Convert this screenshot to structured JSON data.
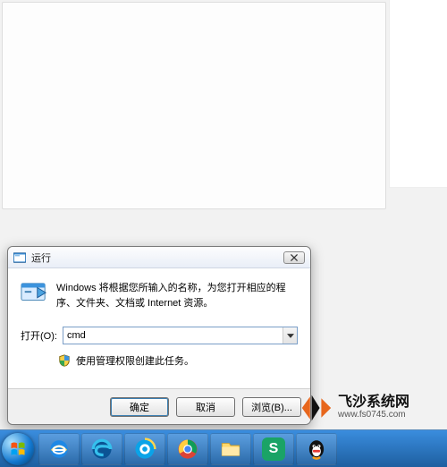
{
  "dialog": {
    "title": "运行",
    "description": "Windows 将根据您所输入的名称，为您打开相应的程序、文件夹、文档或 Internet 资源。",
    "open_label": "打开(O):",
    "input_value": "cmd",
    "admin_note": "使用管理权限创建此任务。",
    "buttons": {
      "ok": "确定",
      "cancel": "取消",
      "browse": "浏览(B)..."
    }
  },
  "taskbar": {
    "items": [
      {
        "name": "start-orb",
        "icon": "windows-logo"
      },
      {
        "name": "internet-explorer",
        "icon": "ie"
      },
      {
        "name": "microsoft-edge",
        "icon": "edge"
      },
      {
        "name": "qq-browser",
        "icon": "qqbrowser"
      },
      {
        "name": "google-chrome",
        "icon": "chrome"
      },
      {
        "name": "file-explorer",
        "icon": "explorer"
      },
      {
        "name": "wps-spreadsheet",
        "icon": "wps-s"
      },
      {
        "name": "qq",
        "icon": "qq"
      }
    ]
  },
  "watermark": {
    "brand": "飞沙系统网",
    "url_text": "www.fs0745.com"
  }
}
